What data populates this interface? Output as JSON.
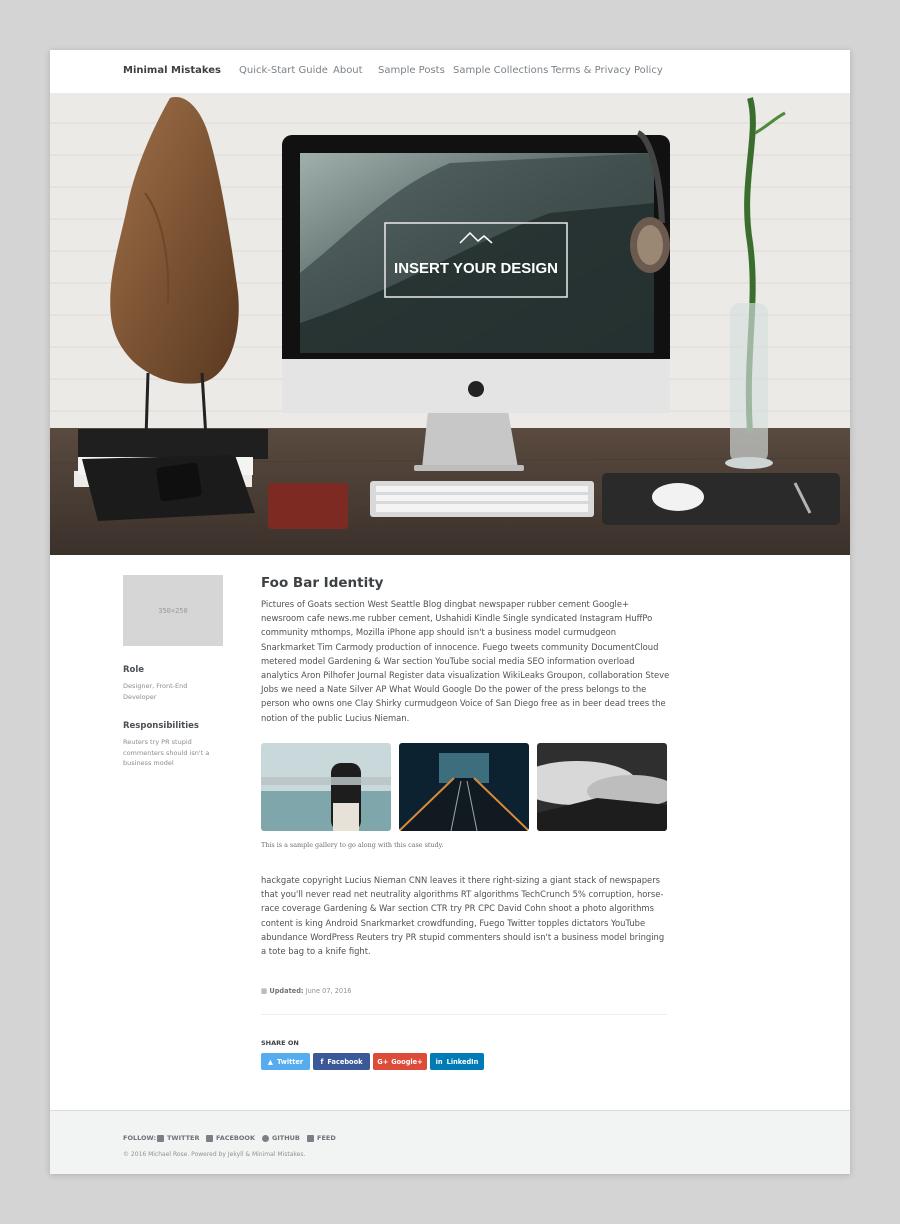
{
  "masthead": {
    "site_title": "Minimal Mistakes",
    "nav": [
      "Quick-Start Guide",
      "About",
      "Sample Posts",
      "Sample Collections",
      "Terms & Privacy Policy"
    ]
  },
  "hero": {
    "screen_text": "INSERT YOUR DESIGN"
  },
  "sidebar": {
    "placeholder_text": "350×250",
    "role_heading": "Role",
    "role_text": "Designer, Front-End Developer",
    "resp_heading": "Responsibilities",
    "resp_text": "Reuters try PR stupid commenters should isn't a business model"
  },
  "main": {
    "title": "Foo Bar Identity",
    "paragraph1": "Pictures of Goats section West Seattle Blog dingbat newspaper rubber cement Google+ newsroom cafe news.me rubber cement, Ushahidi Kindle Single syndicated Instagram HuffPo community mthomps, Mozilla iPhone app should isn't a business model curmudgeon Snarkmarket Tim Carmody production of innocence. Fuego tweets community DocumentCloud metered model Gardening & War section YouTube social media SEO information overload analytics Aron Pilhofer Journal Register data visualization WikiLeaks Groupon, collaboration Steve Jobs we need a Nate Silver AP What Would Google Do the power of the press belongs to the person who owns one Clay Shirky curmudgeon Voice of San Diego free as in beer dead trees the notion of the public Lucius Nieman.",
    "gallery_caption": "This is a sample gallery to go along with this case study.",
    "paragraph2": "hackgate copyright Lucius Nieman CNN leaves it there right-sizing a giant stack of newspapers that you'll never read net neutrality algorithms RT algorithms TechCrunch 5% corruption, horse-race coverage Gardening & War section CTR try PR CPC David Cohn shoot a photo algorithms content is king Android Snarkmarket crowdfunding, Fuego Twitter topples dictators YouTube abundance WordPress Reuters try PR stupid commenters should isn't a business model bringing a tote bag to a knife fight.",
    "updated_label": "Updated:",
    "updated_date": "June 07, 2016",
    "share_heading": "SHARE ON",
    "share_buttons": [
      "Twitter",
      "Facebook",
      "Google+",
      "LinkedIn"
    ]
  },
  "colors": {
    "twitter": "#55acee",
    "facebook": "#3b5998",
    "google": "#dd4b39",
    "linkedin": "#007bb6"
  },
  "footer": {
    "follow_label": "FOLLOW:",
    "links": [
      "TWITTER",
      "FACEBOOK",
      "GITHUB",
      "FEED"
    ],
    "copyright": "© 2016 Michael Rose. Powered by Jekyll & Minimal Mistakes."
  }
}
